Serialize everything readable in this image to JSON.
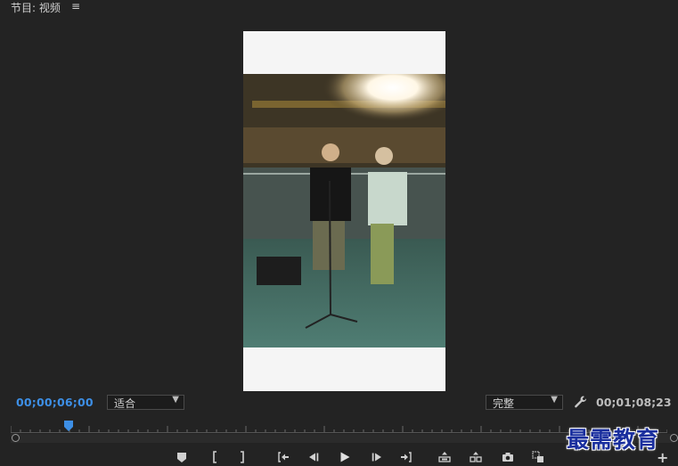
{
  "panel": {
    "title": "节目: 视频",
    "menu_glyph": "≡"
  },
  "playhead_timecode": "00;00;06;00",
  "duration_timecode": "00;01;08;23",
  "fit_select": {
    "value": "适合"
  },
  "quality_select": {
    "value": "完整"
  },
  "playhead_progress": 0.088,
  "controls": [
    "add-marker",
    "mark-in",
    "mark-out",
    "go-to-in",
    "step-back",
    "play",
    "step-forward",
    "go-to-out",
    "lift",
    "extract",
    "export-frame",
    "comparison-view",
    "button-editor"
  ],
  "watermark": "最需教育",
  "colors": {
    "timecode_active": "#3d8fe6",
    "background": "#232323",
    "watermark": "#1a2f9e"
  }
}
